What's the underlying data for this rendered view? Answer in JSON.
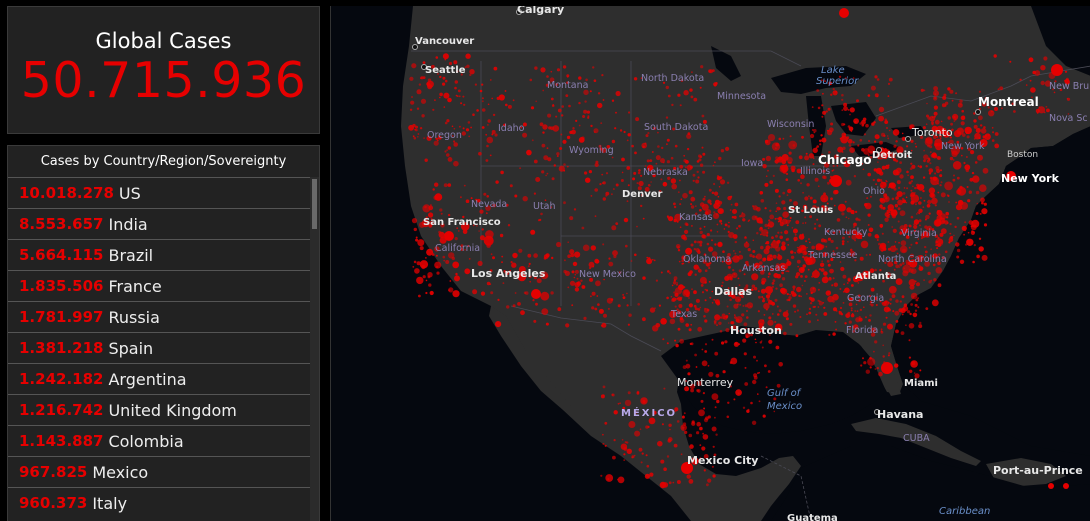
{
  "global": {
    "title": "Global Cases",
    "value": "50.715.936"
  },
  "country_panel": {
    "header": "Cases by Country/Region/Sovereignty",
    "rows": [
      {
        "count": "10.018.278",
        "name": "US"
      },
      {
        "count": "8.553.657",
        "name": "India"
      },
      {
        "count": "5.664.115",
        "name": "Brazil"
      },
      {
        "count": "1.835.506",
        "name": "France"
      },
      {
        "count": "1.781.997",
        "name": "Russia"
      },
      {
        "count": "1.381.218",
        "name": "Spain"
      },
      {
        "count": "1.242.182",
        "name": "Argentina"
      },
      {
        "count": "1.216.742",
        "name": "United Kingdom"
      },
      {
        "count": "1.143.887",
        "name": "Colombia"
      },
      {
        "count": "967.825",
        "name": "Mexico"
      },
      {
        "count": "960.373",
        "name": "Italy"
      }
    ]
  },
  "map": {
    "cities": {
      "calgary": "Calgary",
      "vancouver": "Vancouver",
      "seattle": "Seattle",
      "san_francisco": "San Francisco",
      "los_angeles": "Los Angeles",
      "denver": "Denver",
      "chicago": "Chicago",
      "detroit": "Detroit",
      "toronto": "Toronto",
      "montreal": "Montreal",
      "new_york": "New York",
      "boston": "Boston",
      "st_louis": "St Louis",
      "dallas": "Dallas",
      "houston": "Houston",
      "atlanta": "Atlanta",
      "miami": "Miami",
      "monterrey": "Monterrey",
      "mexico_city": "Mexico City",
      "havana": "Havana",
      "port_au_prince": "Port-au-Prince",
      "guatemala": "Guatema"
    },
    "states": {
      "north_dakota": "North Dakota",
      "montana": "Montana",
      "minnesota": "Minnesota",
      "idaho": "Idaho",
      "south_dakota": "South Dakota",
      "wisconsin": "Wisconsin",
      "oregon": "Oregon",
      "wyoming": "Wyoming",
      "iowa": "Iowa",
      "nebraska": "Nebraska",
      "nevada": "Nevada",
      "utah": "Utah",
      "illinois": "Illinois",
      "ohio": "Ohio",
      "new_york_state": "New York",
      "kansas": "Kansas",
      "california": "California",
      "kentucky": "Kentucky",
      "virginia": "Virginia",
      "oklahoma": "Oklahoma",
      "arkansas": "Arkansas",
      "tennessee": "Tennessee",
      "north_carolina": "North Carolina",
      "new_mexico": "New Mexico",
      "georgia": "Georgia",
      "texas": "Texas",
      "florida": "Florida",
      "new_brunswick": "New Brunswick",
      "nova_scotia": "Nova Sc"
    },
    "regions": {
      "mexico": "MÉXICO",
      "cuba": "CUBA"
    },
    "water": {
      "lake_superior_1": "Lake",
      "lake_superior_2": "Superior",
      "gulf_1": "Gulf of",
      "gulf_2": "Mexico",
      "caribbean": "Caribbean"
    },
    "colors": {
      "cases": "#e60000",
      "land": "#2e2e2e",
      "water": "#05080f"
    }
  }
}
